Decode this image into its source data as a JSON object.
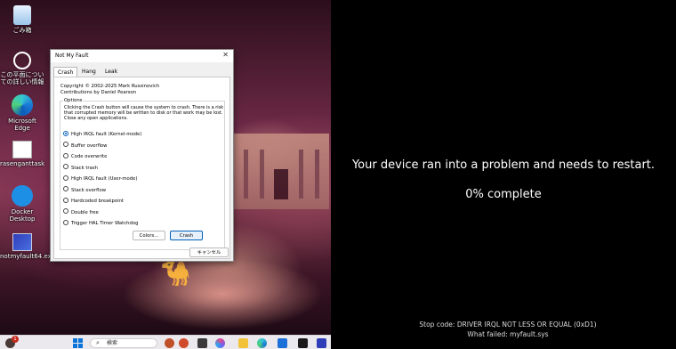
{
  "desktop": {
    "icons": [
      {
        "label": "ごみ箱",
        "icon": "recycle-bin-icon"
      },
      {
        "label": "この平面についての詳しい情報",
        "icon": "info-icon"
      },
      {
        "label": "Microsoft Edge",
        "icon": "edge-icon"
      },
      {
        "label": "rasenganttask",
        "icon": "app-icon"
      },
      {
        "label": "Docker Desktop",
        "icon": "docker-icon"
      },
      {
        "label": "notmyfault64.exe",
        "icon": "notmyfault-icon"
      }
    ]
  },
  "dialog": {
    "title": "Not My Fault",
    "tabs": [
      "Crash",
      "Hang",
      "Leak"
    ],
    "active_tab": "Crash",
    "copyright": "Copyright © 2002-2025 Mark Russinovich",
    "contributions": "Contributions by Daniel Pearson",
    "group_label": "Options",
    "description": "Clicking the Crash button will cause the system to crash. There is a risk that corrupted memory will be written to disk or that work may be lost. Close any open applications.",
    "options": [
      "High IRQL fault (Kernel-mode)",
      "Buffer overflow",
      "Code overwrite",
      "Stack trash",
      "High IRQL fault (User-mode)",
      "Stack overflow",
      "Hardcoded breakpoint",
      "Double free",
      "Trigger HAL Timer Watchdog"
    ],
    "selected_option": "High IRQL fault (Kernel-mode)",
    "colors_button": "Colors...",
    "crash_button": "Crash",
    "cancel_button": "キャンセル"
  },
  "taskbar": {
    "notification_count": "1",
    "search_placeholder": "検索"
  },
  "bsod": {
    "message": "Your device ran into a problem and needs to restart.",
    "progress": "0% complete",
    "stop_code": "Stop code: DRIVER IRQL NOT LESS OR EQUAL (0xD1)",
    "what_failed": "What failed: myfault.sys"
  }
}
